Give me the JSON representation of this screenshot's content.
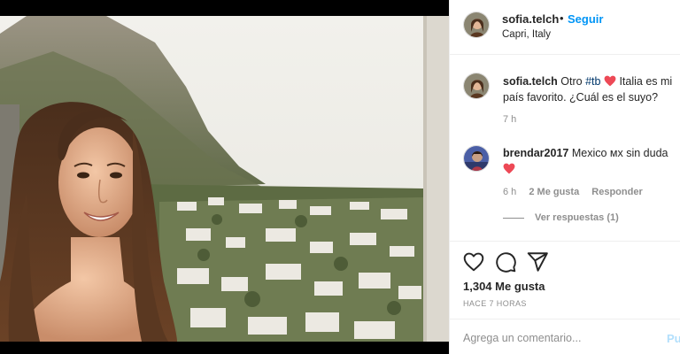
{
  "post": {
    "image_alt": "Foto de una mujer sonriente frente a un pueblo costero y montañas"
  },
  "header": {
    "username": "sofia.telch",
    "separator": "•",
    "follow_label": "Seguir",
    "location": "Capri, Italy"
  },
  "caption": {
    "username": "sofia.telch",
    "text_before": " Otro ",
    "hashtag": "#tb",
    "text_after": " Italia es mi país favorito. ¿Cuál es el suyo?",
    "time": "7 h"
  },
  "comment": {
    "username": "brendar2017",
    "text": " Mexico ᴍx sin duda ",
    "time": "6 h",
    "likes": "2 Me gusta",
    "reply_label": "Responder",
    "view_replies": "Ver respuestas (1)"
  },
  "actions": {
    "likes": "1,304 Me gusta",
    "time": "HACE 7 HORAS"
  },
  "add_comment": {
    "placeholder": "Agrega un comentario...",
    "post_label": "Pu"
  },
  "colors": {
    "link_blue": "#0095f6",
    "heart_red": "#ed4956",
    "post_disabled": "#b2dffc"
  },
  "icons": [
    "heart-icon",
    "comment-icon",
    "share-icon"
  ]
}
